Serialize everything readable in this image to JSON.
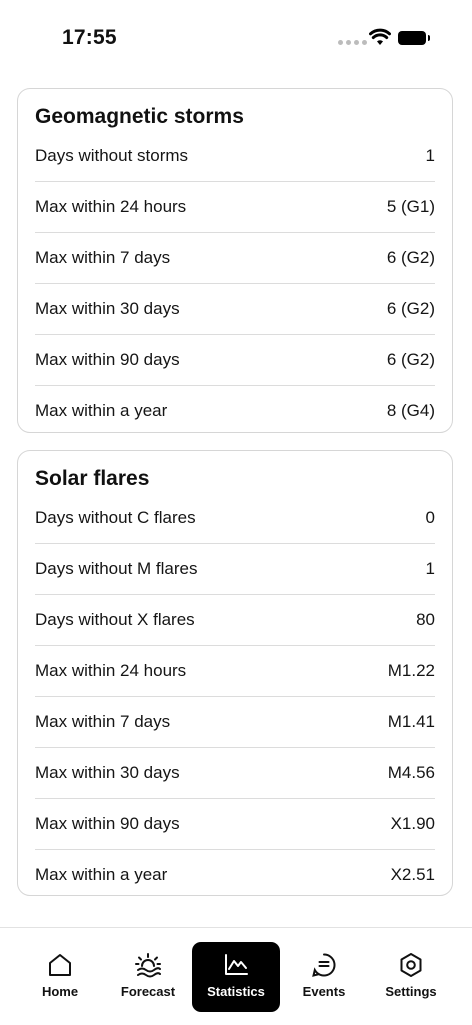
{
  "status": {
    "time": "17:55"
  },
  "storms": {
    "title": "Geomagnetic storms",
    "rows": [
      {
        "label": "Days without storms",
        "value": "1"
      },
      {
        "label": "Max within 24 hours",
        "value": "5 (G1)"
      },
      {
        "label": "Max within 7 days",
        "value": "6 (G2)"
      },
      {
        "label": "Max within 30 days",
        "value": "6 (G2)"
      },
      {
        "label": "Max within 90 days",
        "value": "6 (G2)"
      },
      {
        "label": "Max within a year",
        "value": "8 (G4)"
      }
    ]
  },
  "flares": {
    "title": "Solar flares",
    "rows": [
      {
        "label": "Days without C flares",
        "value": "0"
      },
      {
        "label": "Days without M flares",
        "value": "1"
      },
      {
        "label": "Days without X flares",
        "value": "80"
      },
      {
        "label": "Max within 24 hours",
        "value": "M1.22"
      },
      {
        "label": "Max within 7 days",
        "value": "M1.41"
      },
      {
        "label": "Max within 30 days",
        "value": "M4.56"
      },
      {
        "label": "Max within 90 days",
        "value": "X1.90"
      },
      {
        "label": "Max within a year",
        "value": "X2.51"
      }
    ]
  },
  "tabs": [
    {
      "label": "Home",
      "icon": "home-icon"
    },
    {
      "label": "Forecast",
      "icon": "forecast-icon"
    },
    {
      "label": "Statistics",
      "icon": "statistics-icon",
      "active": true
    },
    {
      "label": "Events",
      "icon": "events-icon"
    },
    {
      "label": "Settings",
      "icon": "settings-icon"
    }
  ]
}
